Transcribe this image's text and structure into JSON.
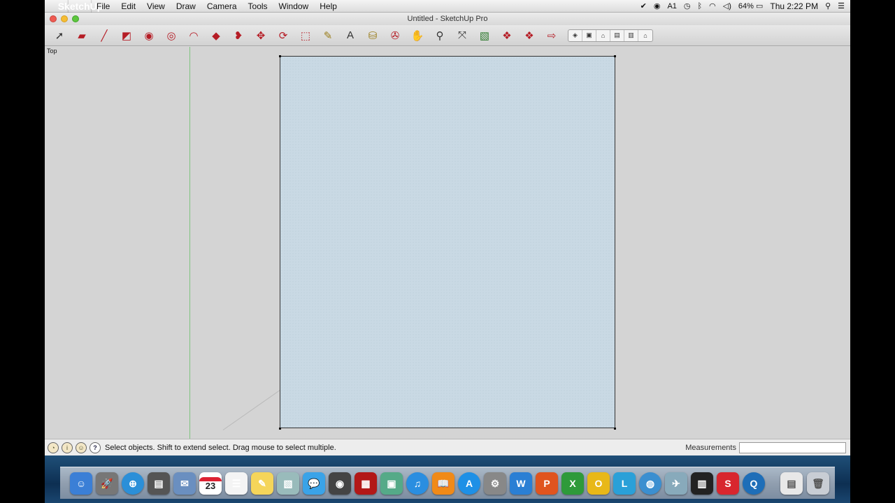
{
  "menubar": {
    "apple_glyph": "",
    "app_name": "SketchUp",
    "menus": [
      "File",
      "Edit",
      "View",
      "Draw",
      "Camera",
      "Tools",
      "Window",
      "Help"
    ],
    "status_icons": [
      "checkmark-icon",
      "record-icon",
      "adobe-icon",
      "time-machine-icon",
      "bluetooth-icon",
      "wifi-icon",
      "volume-icon"
    ],
    "adobe_count": "1",
    "battery": "64%",
    "clock": "Thu 2:22 PM"
  },
  "window": {
    "title": "Untitled - SketchUp Pro"
  },
  "toolbar": {
    "tools": [
      {
        "name": "select-tool",
        "glyph": "➚"
      },
      {
        "name": "eraser-tool",
        "glyph": "▰"
      },
      {
        "name": "line-tool",
        "glyph": "╱"
      },
      {
        "name": "rectangle-tool",
        "glyph": "◩"
      },
      {
        "name": "circle-tool",
        "glyph": "◉"
      },
      {
        "name": "polygon-tool",
        "glyph": "◎"
      },
      {
        "name": "arc-tool",
        "glyph": "◠"
      },
      {
        "name": "push-pull-tool",
        "glyph": "◆"
      },
      {
        "name": "follow-me-tool",
        "glyph": "❥"
      },
      {
        "name": "move-tool",
        "glyph": "✥"
      },
      {
        "name": "rotate-tool",
        "glyph": "⟳"
      },
      {
        "name": "scale-tool",
        "glyph": "⬚"
      },
      {
        "name": "tape-measure-tool",
        "glyph": "✎"
      },
      {
        "name": "text-tool",
        "glyph": "A"
      },
      {
        "name": "paint-bucket-tool",
        "glyph": "⛁"
      },
      {
        "name": "orbit-tool",
        "glyph": "✇"
      },
      {
        "name": "pan-tool",
        "glyph": "✋"
      },
      {
        "name": "zoom-tool",
        "glyph": "⚲"
      },
      {
        "name": "zoom-extents-tool",
        "glyph": "⤧"
      },
      {
        "name": "section-plane-tool",
        "glyph": "▧"
      },
      {
        "name": "warehouse-tool",
        "glyph": "❖"
      },
      {
        "name": "share-model-tool",
        "glyph": "❖"
      },
      {
        "name": "extension-tool",
        "glyph": "⇨"
      }
    ],
    "views": [
      "iso-view",
      "top-view",
      "front-view",
      "right-view",
      "back-view",
      "left-view"
    ]
  },
  "viewport": {
    "view_label": "Top"
  },
  "statusbar": {
    "hint": "Select objects. Shift to extend select. Drag mouse to select multiple.",
    "measurements_label": "Measurements",
    "measurements_value": ""
  },
  "dock": {
    "apps": [
      {
        "name": "finder-app",
        "bg": "#3b7fd6",
        "glyph": "☺"
      },
      {
        "name": "launchpad-app",
        "bg": "#777",
        "glyph": "🚀"
      },
      {
        "name": "safari-app",
        "bg": "#2b8fd8",
        "glyph": "⊕"
      },
      {
        "name": "photo-browser-app",
        "bg": "#555",
        "glyph": "▤"
      },
      {
        "name": "mail-app",
        "bg": "#6a8fc0",
        "glyph": "✉"
      },
      {
        "name": "calendar-app",
        "bg": "#ffffff",
        "glyph": "23"
      },
      {
        "name": "reminders-app",
        "bg": "#f4f4f4",
        "glyph": "☰"
      },
      {
        "name": "notes-app",
        "bg": "#f5d55a",
        "glyph": "✎"
      },
      {
        "name": "preview-app",
        "bg": "#9bb",
        "glyph": "▧"
      },
      {
        "name": "messages-app",
        "bg": "#3aa3e8",
        "glyph": "💬"
      },
      {
        "name": "facetime-app",
        "bg": "#444",
        "glyph": "◉"
      },
      {
        "name": "photo-booth-app",
        "bg": "#b21818",
        "glyph": "▦"
      },
      {
        "name": "iphoto-app",
        "bg": "#5a8",
        "glyph": "▣"
      },
      {
        "name": "itunes-app",
        "bg": "#2a8ee0",
        "glyph": "♫"
      },
      {
        "name": "ibooks-app",
        "bg": "#f08a18",
        "glyph": "📖"
      },
      {
        "name": "app-store-app",
        "bg": "#1e90e6",
        "glyph": "A"
      },
      {
        "name": "system-preferences-app",
        "bg": "#888",
        "glyph": "⚙"
      },
      {
        "name": "word-app",
        "bg": "#2a7fd4",
        "glyph": "W"
      },
      {
        "name": "powerpoint-app",
        "bg": "#e0541e",
        "glyph": "P"
      },
      {
        "name": "excel-app",
        "bg": "#2e9a3a",
        "glyph": "X"
      },
      {
        "name": "outlook-app",
        "bg": "#e8b818",
        "glyph": "O"
      },
      {
        "name": "lync-app",
        "bg": "#2aa0d8",
        "glyph": "L"
      },
      {
        "name": "network-app",
        "bg": "#3b8fd0",
        "glyph": "◍"
      },
      {
        "name": "image-capture-app",
        "bg": "#8ab",
        "glyph": "✈"
      },
      {
        "name": "keyboard-app",
        "bg": "#222",
        "glyph": "▥"
      },
      {
        "name": "sketchup-app",
        "bg": "#d8262e",
        "glyph": "S"
      },
      {
        "name": "quicktime-app",
        "bg": "#1e6eb8",
        "glyph": "Q"
      }
    ],
    "calendar_day": "23",
    "trailing": [
      {
        "name": "documents-stack",
        "bg": "#e8e8e8",
        "glyph": "▤"
      },
      {
        "name": "trash-bin",
        "bg": "#c8cdd4",
        "glyph": "🗑"
      }
    ]
  }
}
